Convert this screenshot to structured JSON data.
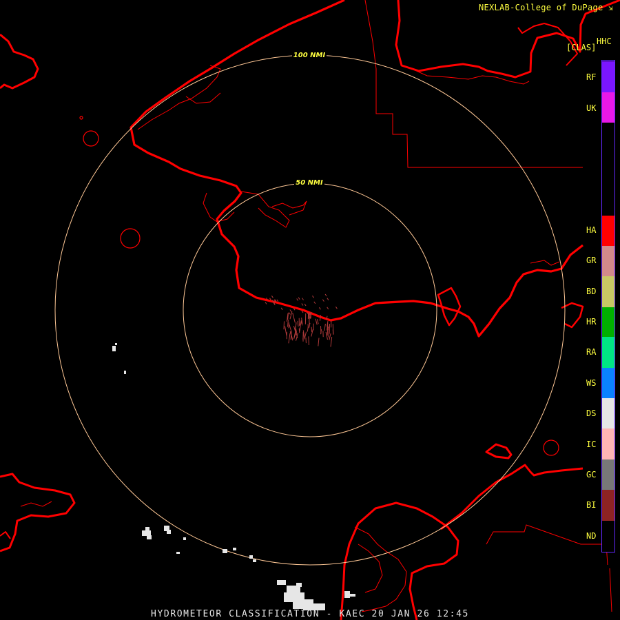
{
  "header": {
    "credit": "NEXLAB-College of DuPage",
    "product_code": "HHC",
    "product_unit": "[CLAS]"
  },
  "footer": {
    "title": "HYDROMETEOR CLASSIFICATION - KAEC 20 JAN 26 12:45"
  },
  "range_rings": [
    {
      "label": "50 NMI"
    },
    {
      "label": "100 NMI"
    }
  ],
  "legend": {
    "items": [
      {
        "code": "RF",
        "color": "#7b16ff"
      },
      {
        "code": "UK",
        "color": "#e818e8"
      },
      {
        "code": "HA",
        "color": "#ff0000"
      },
      {
        "code": "GR",
        "color": "#d28a8a"
      },
      {
        "code": "BD",
        "color": "#c8c864"
      },
      {
        "code": "HR",
        "color": "#00b000"
      },
      {
        "code": "RA",
        "color": "#00e684"
      },
      {
        "code": "WS",
        "color": "#0a82ff"
      },
      {
        "code": "DS",
        "color": "#e6e6e6"
      },
      {
        "code": "IC",
        "color": "#ffb4b4"
      },
      {
        "code": "GC",
        "color": "#787878"
      },
      {
        "code": "BI",
        "color": "#8c2323"
      },
      {
        "code": "ND",
        "color": "#000000"
      }
    ]
  },
  "colors": {
    "coastline": "#ff0000",
    "ring": "#ffc896",
    "label": "#ffff40",
    "legend_border": "#6428ff",
    "echo": "#e6e6e6",
    "clutter": "#b03a3a"
  }
}
